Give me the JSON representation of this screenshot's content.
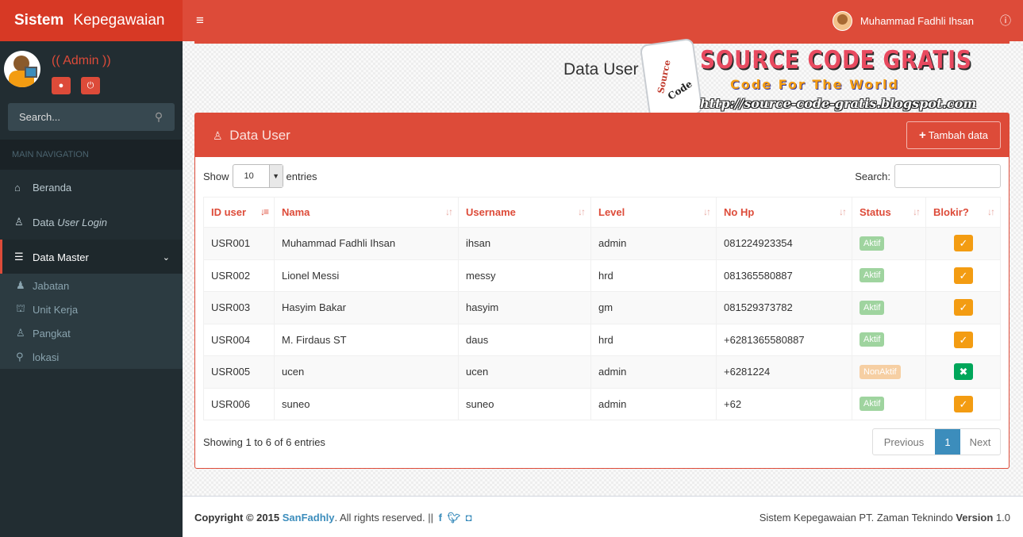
{
  "app": {
    "title_bold": "Sistem",
    "title_rest": "Kepegawaian"
  },
  "header": {
    "menu_icon": "hamburger-icon",
    "user_name": "Muhammad Fadhli Ihsan",
    "info_icon": "info-icon"
  },
  "sidebar": {
    "role_label": "(( Admin ))",
    "search_placeholder": "Search...",
    "nav_header": "MAIN NAVIGATION",
    "items": [
      {
        "label": "Beranda",
        "icon": "home-icon"
      },
      {
        "label_plain": "Data ",
        "label_italic": "User Login",
        "icon": "user-secret-icon"
      },
      {
        "label": "Data Master",
        "icon": "list-icon"
      }
    ],
    "sub_items": [
      {
        "label": "Jabatan",
        "icon": "male-icon"
      },
      {
        "label": "Unit Kerja",
        "icon": "bank-icon"
      },
      {
        "label": "Pangkat",
        "icon": "user-icon"
      },
      {
        "label": "lokasi",
        "icon": "map-marker-icon"
      }
    ]
  },
  "page": {
    "title": "Data User"
  },
  "watermark": {
    "puzzle_text_1": "Source",
    "puzzle_text_2": "Code",
    "title": "SOURCE CODE GRATIS",
    "subtitle": "Code For The World",
    "url": "http://source-code-gratis.blogspot.com"
  },
  "box": {
    "title": "Data User",
    "add_button": "Tambah data",
    "show_label": "Show",
    "entries_value": "10",
    "entries_label": "entries",
    "search_label": "Search:",
    "columns": [
      "ID user",
      "Nama",
      "Username",
      "Level",
      "No Hp",
      "Status",
      "Blokir?"
    ],
    "rows": [
      {
        "id": "USR001",
        "nama": "Muhammad Fadhli Ihsan",
        "username": "ihsan",
        "level": "admin",
        "hp": "081224923354",
        "status": "Aktif",
        "blokir": "check"
      },
      {
        "id": "USR002",
        "nama": "Lionel Messi",
        "username": "messy",
        "level": "hrd",
        "hp": "081365580887",
        "status": "Aktif",
        "blokir": "check"
      },
      {
        "id": "USR003",
        "nama": "Hasyim Bakar",
        "username": "hasyim",
        "level": "gm",
        "hp": "081529373782",
        "status": "Aktif",
        "blokir": "check"
      },
      {
        "id": "USR004",
        "nama": "M. Firdaus ST",
        "username": "daus",
        "level": "hrd",
        "hp": "+6281365580887",
        "status": "Aktif",
        "blokir": "check"
      },
      {
        "id": "USR005",
        "nama": "ucen",
        "username": "ucen",
        "level": "admin",
        "hp": "+6281224",
        "status": "NonAktif",
        "blokir": "cross"
      },
      {
        "id": "USR006",
        "nama": "suneo",
        "username": "suneo",
        "level": "admin",
        "hp": "+62",
        "status": "Aktif",
        "blokir": "check"
      }
    ],
    "info": "Showing 1 to 6 of 6 entries",
    "pager": {
      "prev": "Previous",
      "current": "1",
      "next": "Next"
    }
  },
  "footer": {
    "copyright": "Copyright © 2015",
    "brand": "SanFadhly",
    "rights": ". All rights reserved. ||",
    "app_text": "Sistem Kepegawaian PT. Zaman Teknindo",
    "version_label": "Version",
    "version": "1.0"
  },
  "colors": {
    "primary": "#dd4b39",
    "sidebar": "#222d32",
    "link": "#3c8dbc",
    "warning": "#f39c12",
    "success": "#00a65a"
  }
}
